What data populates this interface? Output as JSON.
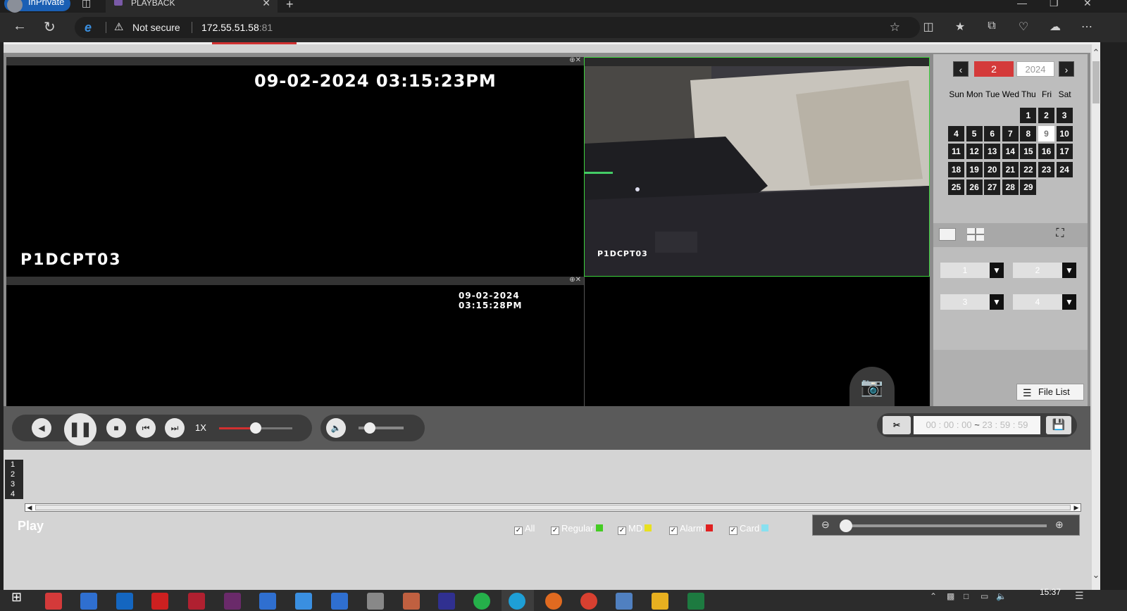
{
  "browser": {
    "inprivate_label": "InPrivate",
    "tab_title": "PLAYBACK",
    "security_label": "Not secure",
    "url_host": "172.55.51.58",
    "url_port": ":81"
  },
  "video": {
    "pane1": {
      "timestamp": "09-02-2024 03:15:23PM",
      "camera": "P1DCPT03"
    },
    "pane2": {
      "camera": "P1DCPT03"
    },
    "pane3": {
      "timestamp": "09-02-2024 03:15:28PM"
    }
  },
  "calendar": {
    "month": "2",
    "year": "2024",
    "weekdays": [
      "Sun",
      "Mon",
      "Tue",
      "Wed",
      "Thu",
      "Fri",
      "Sat"
    ],
    "days": [
      "1",
      "2",
      "3",
      "4",
      "5",
      "6",
      "7",
      "8",
      "9",
      "10",
      "11",
      "12",
      "13",
      "14",
      "15",
      "16",
      "17",
      "18",
      "19",
      "20",
      "21",
      "22",
      "23",
      "24",
      "25",
      "26",
      "27",
      "28",
      "29"
    ],
    "first_weekday": 4,
    "selected_day": 9
  },
  "channels": {
    "ch1": "1",
    "ch2": "2",
    "ch3": "3",
    "ch4": "4"
  },
  "panel": {
    "file_list_label": "File List"
  },
  "controls": {
    "speed_label": "1X",
    "speed_level": 0.5,
    "volume_level": 0.25,
    "time_start": "00 : 00 : 00",
    "time_sep": "~",
    "time_end": "23 : 59 : 59"
  },
  "timeline": {
    "rows": [
      "1",
      "2",
      "3",
      "4"
    ],
    "status_label": "Play",
    "filters": [
      {
        "label": "All",
        "color": ""
      },
      {
        "label": "Regular",
        "color": "#44cc22"
      },
      {
        "label": "MD",
        "color": "#e8e020"
      },
      {
        "label": "Alarm",
        "color": "#e02020"
      },
      {
        "label": "Card",
        "color": "#88e0f0"
      }
    ]
  },
  "taskbar": {
    "clock": "15:37"
  }
}
